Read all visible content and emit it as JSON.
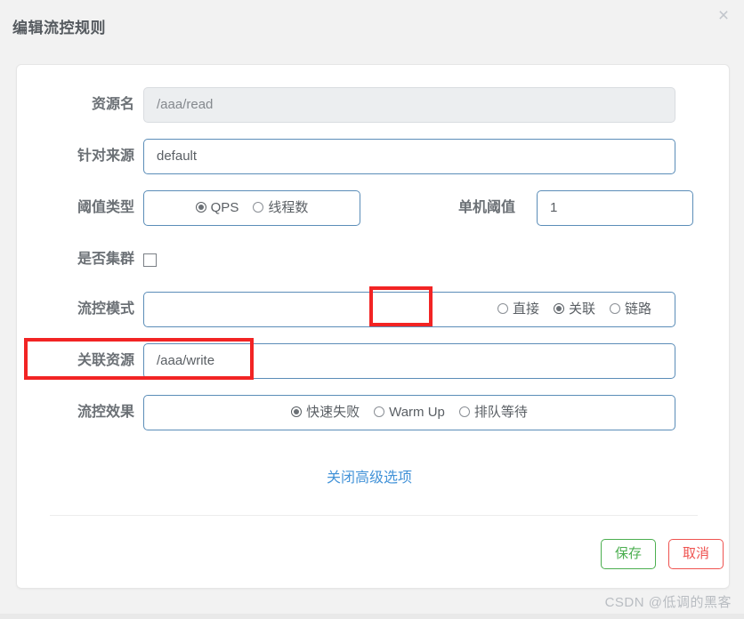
{
  "dialog": {
    "title": "编辑流控规则",
    "close_icon": "×"
  },
  "form": {
    "resource_name": {
      "label": "资源名",
      "value": "/aaa/read",
      "disabled": true
    },
    "origin": {
      "label": "针对来源",
      "value": "default"
    },
    "threshold_type": {
      "label": "阈值类型",
      "options": [
        {
          "label": "QPS",
          "checked": true
        },
        {
          "label": "线程数",
          "checked": false
        }
      ]
    },
    "single_threshold": {
      "label": "单机阈值",
      "value": "1"
    },
    "is_cluster": {
      "label": "是否集群",
      "checked": false
    },
    "flow_mode": {
      "label": "流控模式",
      "options": [
        {
          "label": "直接",
          "checked": false
        },
        {
          "label": "关联",
          "checked": true
        },
        {
          "label": "链路",
          "checked": false
        }
      ]
    },
    "related_resource": {
      "label": "关联资源",
      "value": "/aaa/write"
    },
    "flow_effect": {
      "label": "流控效果",
      "options": [
        {
          "label": "快速失败",
          "checked": true
        },
        {
          "label": "Warm Up",
          "checked": false
        },
        {
          "label": "排队等待",
          "checked": false
        }
      ]
    }
  },
  "advanced_link": "关闭高级选项",
  "footer": {
    "save_label": "保存",
    "cancel_label": "取消"
  },
  "watermark": "CSDN @低调的黑客",
  "colors": {
    "accent_blue": "#4393d8",
    "field_border": "#5b8db8",
    "highlight_red": "#f22424",
    "save_green": "#4caf50",
    "cancel_red": "#ef5350"
  }
}
